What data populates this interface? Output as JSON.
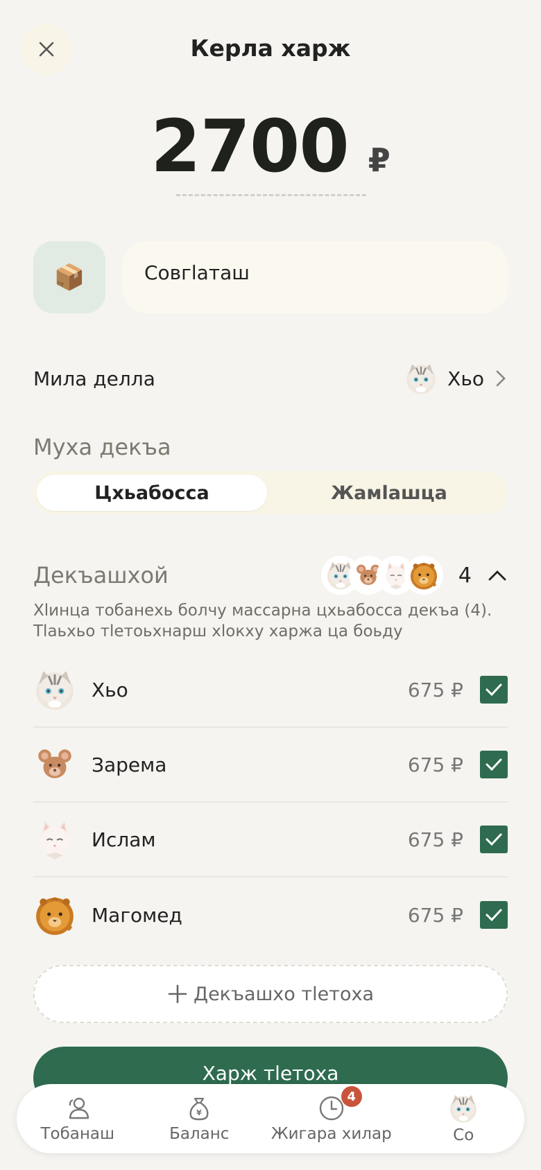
{
  "header": {
    "title": "Керла харж"
  },
  "expense": {
    "amount": "2700",
    "currency": "₽"
  },
  "description": {
    "category_emoji": "📦",
    "value": "Совгӏаташ"
  },
  "payer": {
    "label": "Мила делла",
    "name": "Хьо"
  },
  "split": {
    "heading": "Муха декъа",
    "options": [
      "Цхьабосса",
      "Жамӏашца"
    ],
    "selected": "Цхьабосса"
  },
  "members": {
    "heading": "Декъашхой",
    "count": "4",
    "hint": "Хӏинца тобанехь болчу массарна цхьабосса декъа (4). Тӏаьхьо тӏетоьхнарш хӏокху харжа ца боьду",
    "list": [
      {
        "name": "Хьо",
        "amount": "675 ₽",
        "checked": true
      },
      {
        "name": "Зарема",
        "amount": "675 ₽",
        "checked": true
      },
      {
        "name": "Ислам",
        "amount": "675 ₽",
        "checked": true
      },
      {
        "name": "Магомед",
        "amount": "675 ₽",
        "checked": true
      }
    ],
    "add_label": "Декъашхо тӏетоха"
  },
  "submit": {
    "label": "Харж тӏетоха"
  },
  "tabbar": {
    "tabs": [
      {
        "label": "Тобанаш",
        "icon": "group-icon"
      },
      {
        "label": "Баланс",
        "icon": "money-bag-icon"
      },
      {
        "label": "Жигара хилар",
        "icon": "clock-icon",
        "badge": "4"
      },
      {
        "label": "Со",
        "icon": "profile-avatar"
      }
    ]
  },
  "colors": {
    "accent": "#2e6b4f",
    "badge": "#c9543c",
    "background": "#f5f4f0"
  }
}
